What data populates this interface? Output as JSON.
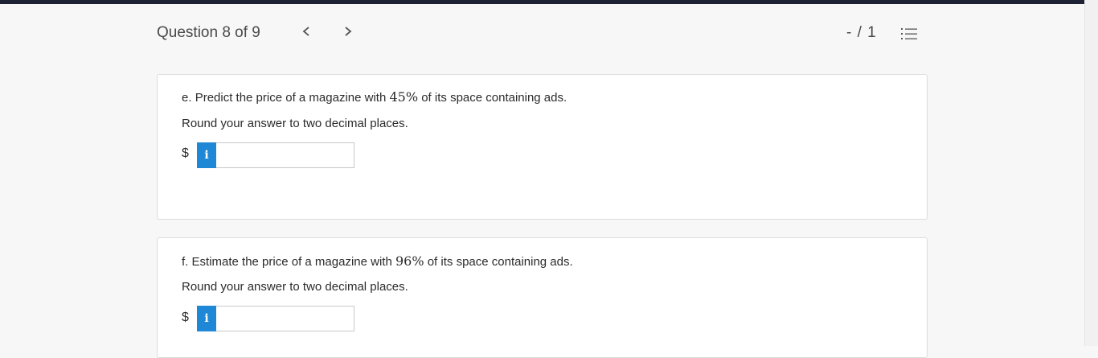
{
  "header": {
    "question_label": "Question 8 of 9",
    "prev_icon": "chevron-left-icon",
    "next_icon": "chevron-right-icon",
    "score": "- / 1",
    "list_icon": "question-list-icon"
  },
  "parts": [
    {
      "letter": "e.",
      "text_before": "Predict the price of a magazine with",
      "percent": "45%",
      "text_after": "of its space containing ads.",
      "instruction": "Round your answer to two decimal places.",
      "currency": "$",
      "info_glyph": "i",
      "answer_value": ""
    },
    {
      "letter": "f.",
      "text_before": "Estimate the price of a magazine with",
      "percent": "96%",
      "text_after": "of its space containing ads.",
      "instruction": "Round your answer to two decimal places.",
      "currency": "$",
      "info_glyph": "i",
      "answer_value": ""
    }
  ],
  "colors": {
    "top_strip": "#1d2235",
    "info_button": "#1e88d6",
    "card_border": "#dcdcdc"
  }
}
